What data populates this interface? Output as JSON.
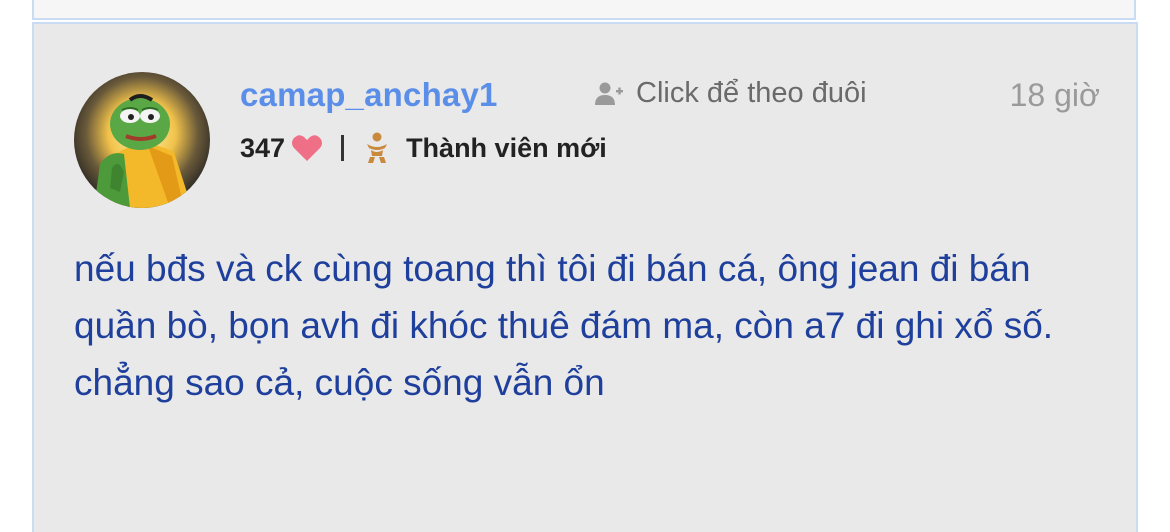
{
  "post": {
    "username": "camap_anchay1",
    "follow_label": "Click để theo đuôi",
    "time": "18 giờ",
    "likes": "347",
    "rank": "Thành viên mới",
    "content": "nếu bđs và ck cùng toang thì tôi đi bán cá, ông jean đi bán quần bò, bọn avh đi khóc thuê đám ma, còn a7 đi ghi xổ số. chẳng sao cả, cuộc sống vẫn ổn"
  },
  "icons": {
    "follow": "add-user-icon",
    "like": "heart-icon",
    "rank": "rank-badge-icon"
  },
  "colors": {
    "username": "#5b8ee8",
    "content_text": "#1e3f9c",
    "heart": "#ef6f86",
    "rank_icon": "#c98a3e",
    "card_bg": "#e9e9e9",
    "card_border": "#c9dcf3"
  }
}
